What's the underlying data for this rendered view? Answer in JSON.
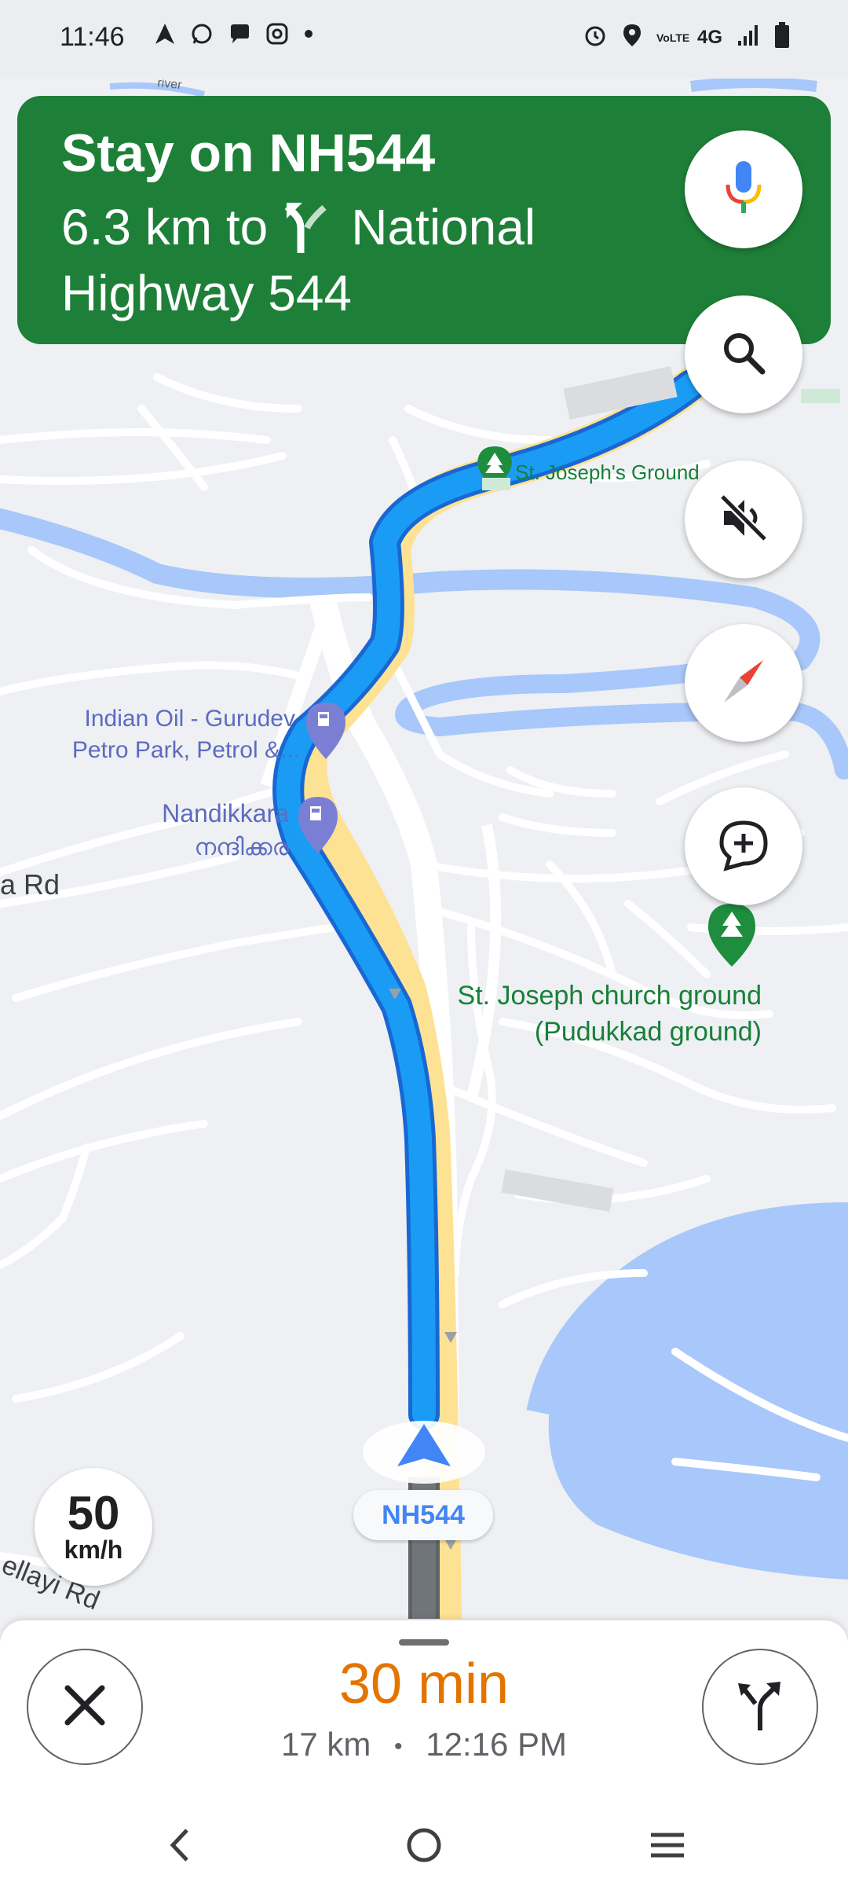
{
  "status_bar": {
    "time": "11:46",
    "network": "4G",
    "volte": "VoLTE",
    "left_icons": [
      "navigation-icon",
      "whatsapp-icon",
      "chat-icon",
      "instagram-icon",
      "dot-icon"
    ],
    "right_icons": [
      "alarm-icon",
      "location-icon",
      "volte-icon",
      "signal-icon",
      "battery-icon"
    ]
  },
  "navigation": {
    "instruction": "Stay on NH544",
    "distance_prefix": "6.3 km to",
    "destination_line1": "National",
    "destination_line2": "Highway 544",
    "turn_icon": "keep-left-fork-icon",
    "banner_color": "#1e8038"
  },
  "map": {
    "labels": {
      "st_josephs_ground": "St. Joseph's Ground",
      "indian_oil_line1": "Indian Oil - Gurudev",
      "indian_oil_line2": "Petro Park, Petrol &...",
      "nandikkara_line1": "Nandikkara",
      "nandikkara_line2": "നന്ദിക്കര",
      "road_left": "a Rd",
      "church_line1": "St. Joseph church ground",
      "church_line2": "(Pudukkad ground)",
      "road_bottom": "ellayi Rd",
      "river_top": "river"
    },
    "route_label": "NH544",
    "colors": {
      "route": "#1a9cf5",
      "route_outline": "#1967d2",
      "traffic_slow": "#f29900",
      "river": "#a8c7fa",
      "park_marker": "#1e8e3e",
      "fuel_marker": "#7b7fd3"
    }
  },
  "speed_limit": {
    "value": "50",
    "unit": "km/h"
  },
  "eta": {
    "duration": "30 min",
    "distance": "17 km",
    "separator": "•",
    "arrival": "12:16 PM"
  },
  "buttons": {
    "voice": "mic-icon",
    "search": "search-icon",
    "mute": "volume-off-icon",
    "compass": "compass-icon",
    "report": "add-report-icon",
    "close": "close-icon",
    "alternate_routes": "alt-routes-icon"
  }
}
